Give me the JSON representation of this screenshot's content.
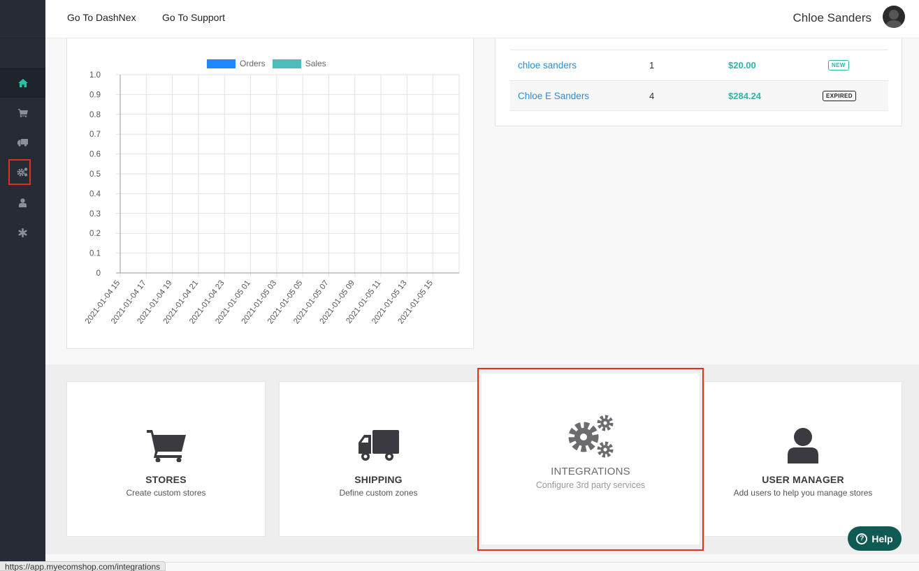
{
  "header": {
    "links": [
      "Go To DashNex",
      "Go To Support"
    ],
    "username": "Chloe Sanders"
  },
  "sidebar": {
    "items": [
      {
        "icon": "home-icon",
        "active": true
      },
      {
        "icon": "cart-icon"
      },
      {
        "icon": "truck-icon"
      },
      {
        "icon": "gears-icon",
        "highlighted": true
      },
      {
        "icon": "user-icon"
      },
      {
        "icon": "asterisk-icon"
      }
    ]
  },
  "chart_data": {
    "type": "bar",
    "legend": [
      "Orders",
      "Sales"
    ],
    "colors": {
      "Orders": "#1e88ff",
      "Sales": "#4dbdba"
    },
    "categories": [
      "2021-01-04 15",
      "2021-01-04 17",
      "2021-01-04 19",
      "2021-01-04 21",
      "2021-01-04 23",
      "2021-01-05 01",
      "2021-01-05 03",
      "2021-01-05 05",
      "2021-01-05 07",
      "2021-01-05 09",
      "2021-01-05 11",
      "2021-01-05 13",
      "2021-01-05 15"
    ],
    "series": [
      {
        "name": "Orders",
        "values": [
          0,
          0,
          0,
          0,
          0,
          0,
          0,
          0,
          0,
          0,
          0,
          0,
          0
        ]
      },
      {
        "name": "Sales",
        "values": [
          0,
          0,
          0,
          0,
          0,
          0,
          0,
          0,
          0,
          0,
          0,
          0,
          0
        ]
      }
    ],
    "yticks": [
      "1.0",
      "0.9",
      "0.8",
      "0.7",
      "0.6",
      "0.5",
      "0.4",
      "0.3",
      "0.2",
      "0.1",
      "0"
    ],
    "ylim": [
      0,
      1.0
    ],
    "grid": true,
    "legend_position": "top"
  },
  "orders_table": {
    "rows": [
      {
        "name": "chloe sanders",
        "qty": "1",
        "amount": "$20.00",
        "status": "NEW"
      },
      {
        "name": "Chloe E Sanders",
        "qty": "4",
        "amount": "$284.24",
        "status": "EXPIRED"
      }
    ]
  },
  "cards": [
    {
      "title": "STORES",
      "subtitle": "Create custom stores",
      "icon": "cart-icon"
    },
    {
      "title": "SHIPPING",
      "subtitle": "Define custom zones",
      "icon": "truck-icon"
    },
    {
      "title": "INTEGRATIONS",
      "subtitle": "Configure 3rd party services",
      "icon": "gears-icon"
    },
    {
      "title": "USER MANAGER",
      "subtitle": "Add users to help you manage stores",
      "icon": "user-icon"
    }
  ],
  "help_label": "Help",
  "status_url": "https://app.myecomshop.com/integrations"
}
